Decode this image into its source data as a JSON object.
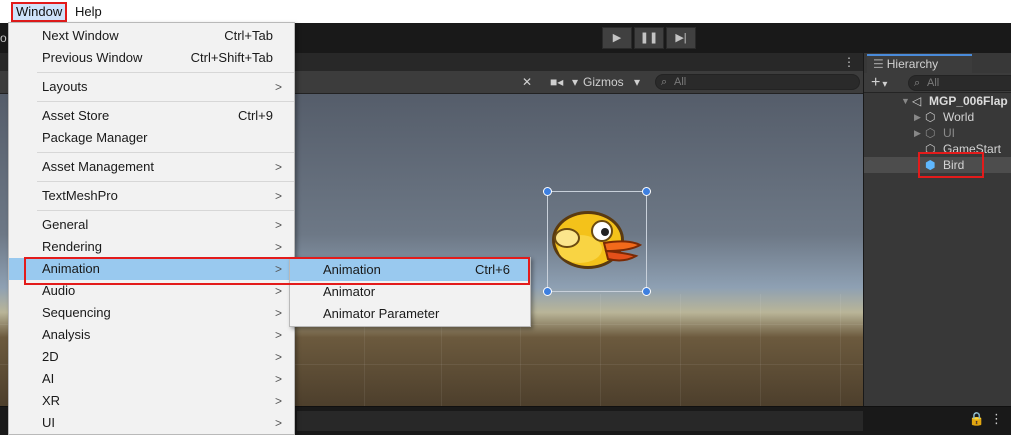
{
  "menubar": {
    "window_label": "Window",
    "help_label": "Help"
  },
  "window_menu": {
    "items": [
      {
        "label": "Next Window",
        "shortcut": "Ctrl+Tab"
      },
      {
        "label": "Previous Window",
        "shortcut": "Ctrl+Shift+Tab"
      },
      {
        "label": "Layouts",
        "arrow": ">"
      },
      {
        "label": "Asset Store",
        "shortcut": "Ctrl+9"
      },
      {
        "label": "Package Manager"
      },
      {
        "label": "Asset Management",
        "arrow": ">"
      },
      {
        "label": "TextMeshPro",
        "arrow": ">"
      },
      {
        "label": "General",
        "arrow": ">"
      },
      {
        "label": "Rendering",
        "arrow": ">"
      },
      {
        "label": "Animation",
        "arrow": ">",
        "highlighted": true
      },
      {
        "label": "Audio",
        "arrow": ">"
      },
      {
        "label": "Sequencing",
        "arrow": ">"
      },
      {
        "label": "Analysis",
        "arrow": ">"
      },
      {
        "label": "2D",
        "arrow": ">"
      },
      {
        "label": "AI",
        "arrow": ">"
      },
      {
        "label": "XR",
        "arrow": ">"
      },
      {
        "label": "UI",
        "arrow": ">"
      }
    ]
  },
  "animation_submenu": {
    "items": [
      {
        "label": "Animation",
        "shortcut": "Ctrl+6",
        "highlighted": true
      },
      {
        "label": "Animator"
      },
      {
        "label": "Animator Parameter"
      }
    ]
  },
  "toolbar": {
    "play_glyph": "▶",
    "pause_glyph": "❚❚",
    "step_glyph": "▶|",
    "left_fragment": "o"
  },
  "scene_toolbar": {
    "tools_glyph": "✕",
    "camera_glyph": "■◂",
    "dropdown_glyph": "▾",
    "gizmos_label": "Gizmos",
    "search_placeholder": "All",
    "more_glyph": "⋮"
  },
  "hierarchy": {
    "tab_label": "Hierarchy",
    "search_placeholder": "All",
    "add_glyph": "+",
    "rows": [
      {
        "label": "MGP_006Flap",
        "icon": "unity-scene-icon",
        "depth": 0,
        "expanded": true
      },
      {
        "label": "World",
        "icon": "gameobject-icon",
        "depth": 1,
        "collapsed": true
      },
      {
        "label": "UI",
        "icon": "gameobject-icon",
        "depth": 1,
        "collapsed": true,
        "dimmed": true
      },
      {
        "label": "GameStart",
        "icon": "gameobject-icon",
        "depth": 1
      },
      {
        "label": "Bird",
        "icon": "gameobject-blue-icon",
        "depth": 1,
        "selected": true
      }
    ]
  },
  "bottom_bar": {
    "lock_glyph": "🔒",
    "more_glyph": "⋮"
  },
  "colors": {
    "highlight": "#99c9ef",
    "annotation_red": "#e31b1b",
    "editor_dark": "#383838"
  }
}
